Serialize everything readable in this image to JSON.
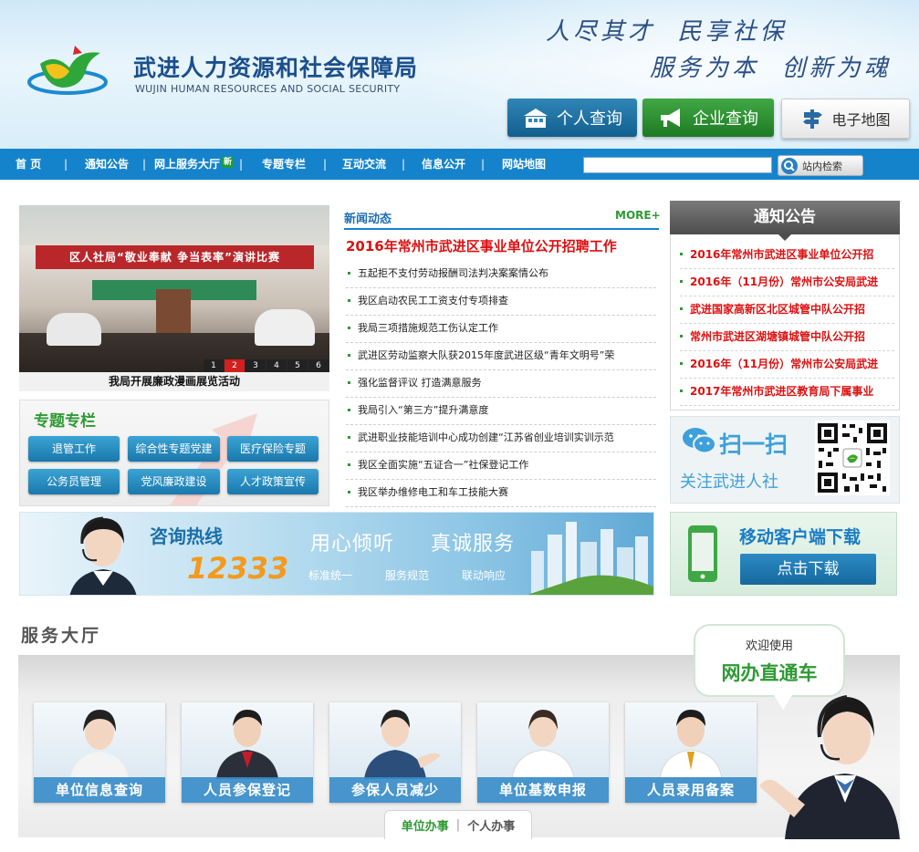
{
  "header": {
    "site_name": "武进人力资源和社会保障局",
    "site_name_en": "WUJIN HUMAN RESOURCES AND SOCIAL SECURITY",
    "slogan_line1": "人尽其才  民享社保",
    "slogan_line2": "服务为本  创新为魂",
    "buttons": {
      "personal": "个人查询",
      "enterprise": "企业查询",
      "map": "电子地图"
    }
  },
  "nav": {
    "items": [
      "首 页",
      "通知公告",
      "网上服务大厅",
      "专题专栏",
      "互动交流",
      "信息公开",
      "网站地图"
    ],
    "separator": "|",
    "new_badge": "新",
    "search_placeholder": "",
    "search_button": "站内检索"
  },
  "slideshow": {
    "banner": "区人社局“敬业奉献 争当表率”演讲比赛",
    "caption": "我局开展廉政漫画展览活动",
    "pages": [
      "1",
      "2",
      "3",
      "4",
      "5",
      "6"
    ],
    "active_page": 2
  },
  "topics": {
    "title": "专题专栏",
    "buttons": [
      "退管工作",
      "综合性专题党建",
      "医疗保险专题",
      "公务员管理",
      "党风廉政建设",
      "人才政策宣传"
    ]
  },
  "news": {
    "title": "新闻动态",
    "more": "MORE+",
    "headline": "2016年常州市武进区事业单位公开招聘工作",
    "items": [
      "五起拒不支付劳动报酬司法判决案案情公布",
      "我区启动农民工工资支付专项排查",
      "我局三项措施规范工伤认定工作",
      "武进区劳动监察大队获2015年度武进区级“青年文明号”荣",
      "强化监督评议 打造满意服务",
      "我局引入“第三方”提升满意度",
      "武进职业技能培训中心成功创建“江苏省创业培训实训示范",
      "我区全面实施“五证合一”社保登记工作",
      "我区举办维修电工和车工技能大赛"
    ]
  },
  "notice": {
    "title": "通知公告",
    "items": [
      "2016年常州市武进区事业单位公开招",
      "2016年（11月份）常州市公安局武进",
      "武进国家高新区北区城管中队公开招",
      "常州市武进区湖塘镇城管中队公开招",
      "2016年（11月份）常州市公安局武进",
      "2017年常州市武进区教育局下属事业"
    ]
  },
  "qr": {
    "title": "扫一扫",
    "subtitle": "关注武进人社"
  },
  "hotline": {
    "title": "咨询热线",
    "number": "12333",
    "slogan1": "用心倾听",
    "slogan2": "真诚服务",
    "tags": [
      "标准统一",
      "服务规范",
      "联动响应"
    ]
  },
  "mobile": {
    "title": "移动客户端下载",
    "button": "点击下载"
  },
  "hall": {
    "title": "服务大厅",
    "cards": [
      "单位信息查询",
      "人员参保登记",
      "参保人员减少",
      "单位基数申报",
      "人员录用备案"
    ],
    "tabs": [
      "单位办事",
      "个人办事"
    ],
    "tab_separator": "|",
    "bubble_small": "欢迎使用",
    "bubble_big": "网办直通车"
  },
  "colors": {
    "nav_blue": "#1583cc",
    "green": "#2e9a34",
    "red": "#dd1111"
  }
}
